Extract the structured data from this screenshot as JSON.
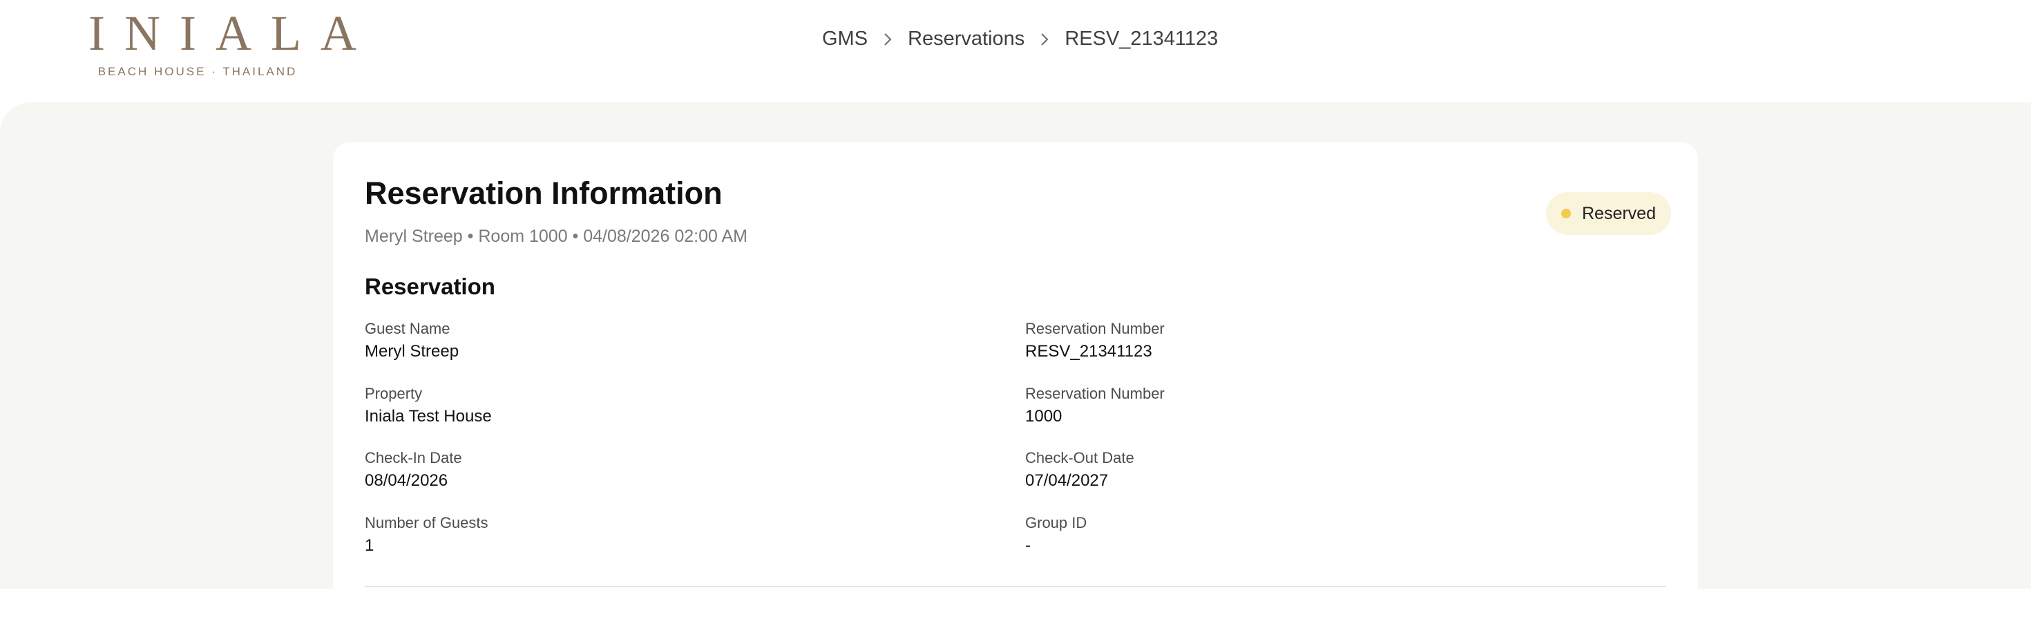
{
  "logo": {
    "main": "INIALA",
    "sub": "BEACH HOUSE · THAILAND"
  },
  "breadcrumb": {
    "items": [
      "GMS",
      "Reservations",
      "RESV_21341123"
    ]
  },
  "card": {
    "title": "Reservation Information",
    "subtitle": "Meryl Streep • Room 1000 • 04/08/2026 02:00 AM",
    "status": {
      "label": "Reserved",
      "dot_color": "#f0cc4f",
      "bg_color": "#fbf4dd"
    },
    "section_title": "Reservation",
    "fields": [
      {
        "label": "Guest Name",
        "value": "Meryl Streep"
      },
      {
        "label": "Reservation Number",
        "value": "RESV_21341123"
      },
      {
        "label": "Property",
        "value": "Iniala Test House"
      },
      {
        "label": "Reservation Number",
        "value": "1000"
      },
      {
        "label": "Check-In Date",
        "value": "08/04/2026"
      },
      {
        "label": "Check-Out Date",
        "value": "07/04/2027"
      },
      {
        "label": "Number of Guests",
        "value": "1"
      },
      {
        "label": "Group ID",
        "value": "-"
      }
    ]
  },
  "colors": {
    "brand": "#8a7560",
    "page_background": "#f6f6f2",
    "card_background": "#ffffff"
  }
}
